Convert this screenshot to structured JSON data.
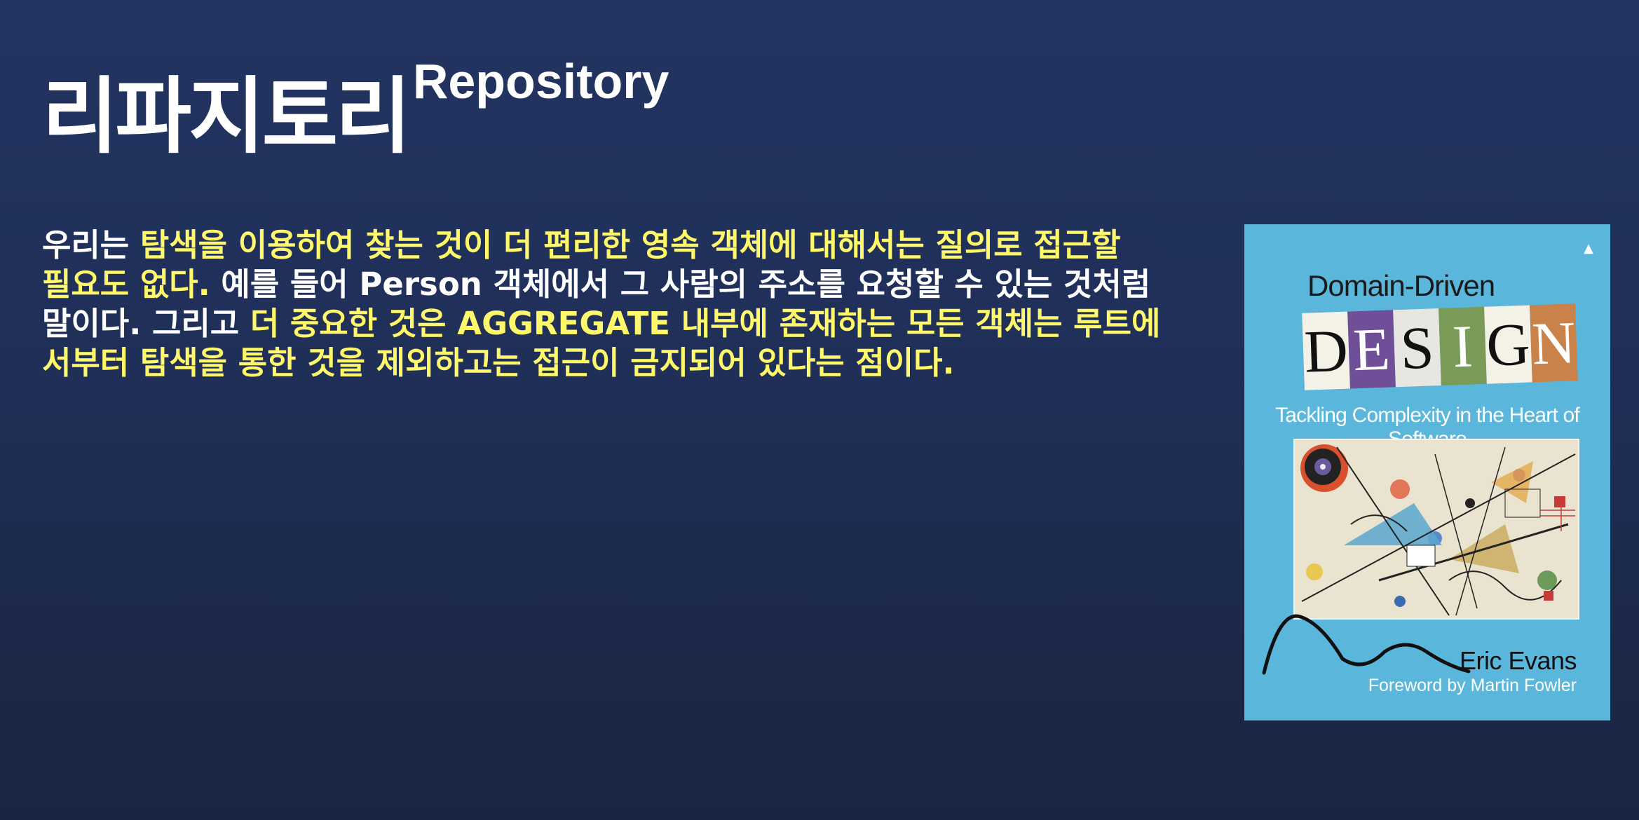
{
  "slide": {
    "title_korean": "리파지토리",
    "title_english": "Repository",
    "paragraph": {
      "line1": [
        {
          "text": "우리는 ",
          "highlight": false
        },
        {
          "text": "탐색을 이용하여 찾는 것이 더 편리한 영속 객체에 대해서는 질의로 접근할",
          "highlight": true
        }
      ],
      "line2": [
        {
          "text": "필요도 없다.",
          "highlight": true
        },
        {
          "text": " 예를 들어 Person 객체에서 그 사람의 주소를 요청할 수 있는 것처럼",
          "highlight": false
        }
      ],
      "line3": [
        {
          "text": "말이다. 그리고 ",
          "highlight": false
        },
        {
          "text": "더 중요한 것은 AGGREGATE 내부에 존재하는 모든 객체는 루트에",
          "highlight": true
        }
      ],
      "line4": [
        {
          "text": "서부터 탐색을 통한 것을 제외하고는 접근이 금지되어 있다는 점이다.",
          "highlight": true
        }
      ]
    },
    "colors": {
      "background": "#1f2f58",
      "text": "#ffffff",
      "highlight": "#fff86a",
      "book_cover": "#5bb6db"
    }
  },
  "book": {
    "publisher_logo": "publisher-logo-icon",
    "title_top": "Domain-Driven",
    "title_letters": [
      "D",
      "E",
      "S",
      "I",
      "G",
      "N"
    ],
    "title_letter_colors": [
      "#f4f1e6",
      "#6f4f97",
      "#e8e6e1",
      "#7a9b57",
      "#f4f1e6",
      "#c9824a"
    ],
    "subtitle": "Tackling Complexity in the Heart of Software",
    "author": "Eric Evans",
    "foreword": "Foreword by Martin Fowler",
    "cover_art": "abstract-painting-image"
  }
}
